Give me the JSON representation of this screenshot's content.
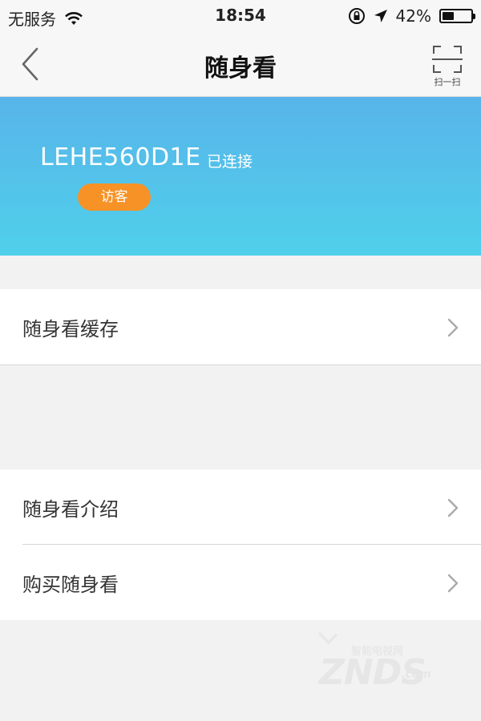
{
  "status_bar": {
    "carrier": "无服务",
    "time": "18:54",
    "battery_text": "42%",
    "battery_level": 0.42,
    "icons": [
      "wifi-icon",
      "rotation-lock-icon",
      "location-arrow-icon",
      "battery-icon"
    ]
  },
  "nav": {
    "title": "随身看",
    "back_icon": "chevron-left-icon",
    "scan_label": "扫一扫",
    "scan_icon": "scan-frame-icon"
  },
  "device": {
    "name": "LEHE560D1E",
    "status": "已连接",
    "role": "访客"
  },
  "menu": {
    "group1": [
      {
        "label": "随身看缓存"
      }
    ],
    "group2": [
      {
        "label": "随身看介绍"
      },
      {
        "label": "购买随身看"
      }
    ]
  },
  "watermark": {
    "top_text": "智能电视网",
    "brand": "ZNDS",
    "suffix": ".com"
  },
  "colors": {
    "banner_top": "#58b4ea",
    "banner_bottom": "#4fd0ea",
    "badge": "#f79226",
    "background": "#f2f2f2"
  }
}
